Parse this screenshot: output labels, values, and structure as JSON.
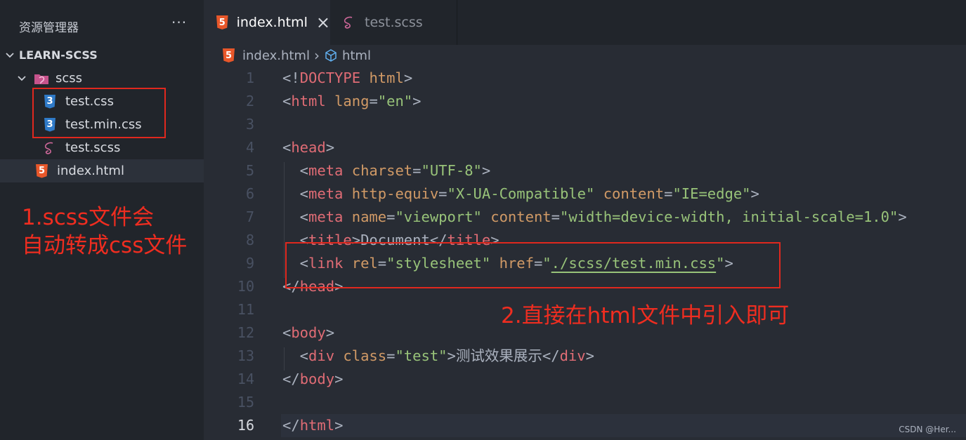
{
  "explorer": {
    "title": "资源管理器",
    "more": "···",
    "project": "LEARN-SCSS",
    "items": [
      {
        "label": "scss",
        "icon": "sass-folder-icon"
      },
      {
        "label": "test.css",
        "icon": "css-file-icon"
      },
      {
        "label": "test.min.css",
        "icon": "css-file-icon"
      },
      {
        "label": "test.scss",
        "icon": "sass-file-icon"
      },
      {
        "label": "index.html",
        "icon": "html-file-icon"
      }
    ]
  },
  "annotations": {
    "note1_line1": "1.scss文件会",
    "note1_line2": "自动转成css文件",
    "note2": "2.直接在html文件中引入即可",
    "color": "#e0281e"
  },
  "tabs": [
    {
      "label": "index.html",
      "close": "×",
      "active": true
    },
    {
      "label": "test.scss",
      "active": false
    }
  ],
  "breadcrumb": {
    "file": "index.html",
    "sep": "›",
    "symbol": "html"
  },
  "editor": {
    "current_line": 16,
    "lines": [
      {
        "n": "1",
        "tokens": [
          [
            "punc",
            "<!"
          ],
          [
            "tag",
            "DOCTYPE"
          ],
          [
            "punc",
            " "
          ],
          [
            "attr",
            "html"
          ],
          [
            "punc",
            ">"
          ]
        ]
      },
      {
        "n": "2",
        "tokens": [
          [
            "punc",
            "<"
          ],
          [
            "tag",
            "html"
          ],
          [
            "punc",
            " "
          ],
          [
            "attr",
            "lang"
          ],
          [
            "punc",
            "="
          ],
          [
            "str",
            "\"en\""
          ],
          [
            "punc",
            ">"
          ]
        ]
      },
      {
        "n": "3",
        "tokens": []
      },
      {
        "n": "4",
        "tokens": [
          [
            "punc",
            "<"
          ],
          [
            "tag",
            "head"
          ],
          [
            "punc",
            ">"
          ]
        ]
      },
      {
        "n": "5",
        "tokens": [
          [
            "punc",
            "  <"
          ],
          [
            "tag",
            "meta"
          ],
          [
            "punc",
            " "
          ],
          [
            "attr",
            "charset"
          ],
          [
            "punc",
            "="
          ],
          [
            "str",
            "\"UTF-8\""
          ],
          [
            "punc",
            ">"
          ]
        ]
      },
      {
        "n": "6",
        "tokens": [
          [
            "punc",
            "  <"
          ],
          [
            "tag",
            "meta"
          ],
          [
            "punc",
            " "
          ],
          [
            "attr",
            "http-equiv"
          ],
          [
            "punc",
            "="
          ],
          [
            "str",
            "\"X-UA-Compatible\""
          ],
          [
            "punc",
            " "
          ],
          [
            "attr",
            "content"
          ],
          [
            "punc",
            "="
          ],
          [
            "str",
            "\"IE=edge\""
          ],
          [
            "punc",
            ">"
          ]
        ]
      },
      {
        "n": "7",
        "tokens": [
          [
            "punc",
            "  <"
          ],
          [
            "tag",
            "meta"
          ],
          [
            "punc",
            " "
          ],
          [
            "attr",
            "name"
          ],
          [
            "punc",
            "="
          ],
          [
            "str",
            "\"viewport\""
          ],
          [
            "punc",
            " "
          ],
          [
            "attr",
            "content"
          ],
          [
            "punc",
            "="
          ],
          [
            "str",
            "\"width=device-width, initial-scale=1.0\""
          ],
          [
            "punc",
            ">"
          ]
        ]
      },
      {
        "n": "8",
        "tokens": [
          [
            "punc",
            "  <"
          ],
          [
            "tag",
            "title"
          ],
          [
            "punc",
            ">"
          ],
          [
            "text",
            "Document"
          ],
          [
            "punc",
            "</"
          ],
          [
            "tag",
            "title"
          ],
          [
            "punc",
            ">"
          ]
        ]
      },
      {
        "n": "9",
        "tokens": [
          [
            "punc",
            "  <"
          ],
          [
            "tag",
            "link"
          ],
          [
            "punc",
            " "
          ],
          [
            "attr",
            "rel"
          ],
          [
            "punc",
            "="
          ],
          [
            "str",
            "\"stylesheet\""
          ],
          [
            "punc",
            " "
          ],
          [
            "attr",
            "href"
          ],
          [
            "punc",
            "="
          ],
          [
            "str",
            "\""
          ],
          [
            "link",
            "./scss/test.min.css"
          ],
          [
            "str",
            "\""
          ],
          [
            "punc",
            ">"
          ]
        ]
      },
      {
        "n": "10",
        "tokens": [
          [
            "punc",
            "</"
          ],
          [
            "tag",
            "head"
          ],
          [
            "punc",
            ">"
          ]
        ]
      },
      {
        "n": "11",
        "tokens": []
      },
      {
        "n": "12",
        "tokens": [
          [
            "punc",
            "<"
          ],
          [
            "tag",
            "body"
          ],
          [
            "punc",
            ">"
          ]
        ]
      },
      {
        "n": "13",
        "tokens": [
          [
            "punc",
            "  <"
          ],
          [
            "tag",
            "div"
          ],
          [
            "punc",
            " "
          ],
          [
            "attr",
            "class"
          ],
          [
            "punc",
            "="
          ],
          [
            "str",
            "\"test\""
          ],
          [
            "punc",
            ">"
          ],
          [
            "text",
            "测试效果展示"
          ],
          [
            "punc",
            "</"
          ],
          [
            "tag",
            "div"
          ],
          [
            "punc",
            ">"
          ]
        ]
      },
      {
        "n": "14",
        "tokens": [
          [
            "punc",
            "</"
          ],
          [
            "tag",
            "body"
          ],
          [
            "punc",
            ">"
          ]
        ]
      },
      {
        "n": "15",
        "tokens": []
      },
      {
        "n": "16",
        "tokens": [
          [
            "punc",
            "</"
          ],
          [
            "tag",
            "html"
          ],
          [
            "punc",
            ">"
          ]
        ]
      }
    ]
  },
  "watermark": "CSDN @Her..."
}
